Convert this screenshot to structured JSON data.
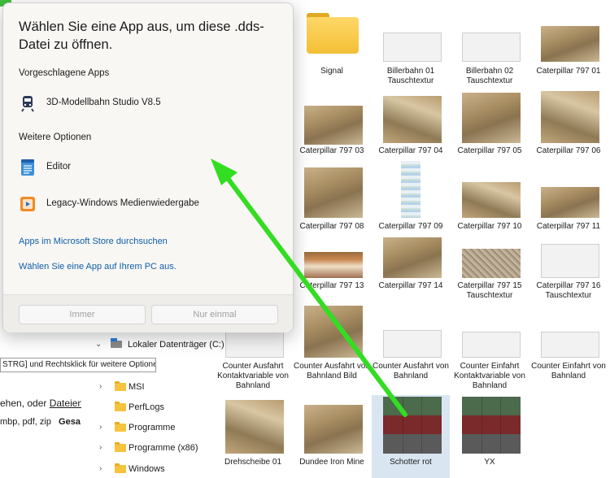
{
  "dialog": {
    "title": "Wählen Sie eine App aus, um diese .dds-Datei zu öffnen.",
    "suggested_header": "Vorgeschlagene Apps",
    "suggested_apps": [
      {
        "label": "3D-Modellbahn Studio V8.5",
        "icon": "train-icon"
      }
    ],
    "more_header": "Weitere Optionen",
    "more_apps": [
      {
        "label": "Editor",
        "icon": "notepad-icon"
      },
      {
        "label": "Legacy-Windows Medienwiedergabe",
        "icon": "media-player-icon"
      }
    ],
    "store_link": "Apps im Microsoft Store durchsuchen",
    "pc_link": "Wählen Sie eine App auf Ihrem PC aus.",
    "btn_always": "Immer",
    "btn_once": "Nur einmal"
  },
  "tooltip": "STRG] und Rechtsklick für weitere Optionen",
  "left_text": {
    "line1_prefix": "ehen, oder ",
    "line1_link": "Dateien",
    "line2": "mbp, pdf, zip",
    "line2_bold": "Gesa"
  },
  "tree": {
    "drive": "Lokaler Datenträger (C:)",
    "cut_label": "er",
    "items": [
      "MSI",
      "PerfLogs",
      "Programme",
      "Programme (x86)",
      "Windows"
    ]
  },
  "files": [
    {
      "name": "Signal",
      "kind": "folder"
    },
    {
      "name": "Billerbahn 01 Tauschtextur",
      "kind": "screen"
    },
    {
      "name": "Billerbahn 02 Tauschtextur",
      "kind": "screen"
    },
    {
      "name": "Caterpillar 797 01",
      "kind": "terrain"
    },
    {
      "name": "Caterpillar 797 03",
      "kind": "terrain"
    },
    {
      "name": "Caterpillar 797 04",
      "kind": "terrain"
    },
    {
      "name": "Caterpillar 797 05",
      "kind": "terrain"
    },
    {
      "name": "Caterpillar 797 06",
      "kind": "terrain"
    },
    {
      "name": "Caterpillar 797 08",
      "kind": "terrain"
    },
    {
      "name": "Caterpillar 797 09",
      "kind": "stripe"
    },
    {
      "name": "Caterpillar 797 10",
      "kind": "terrain"
    },
    {
      "name": "Caterpillar 797 11",
      "kind": "terrain"
    },
    {
      "name": "Caterpillar 797 13",
      "kind": "orange"
    },
    {
      "name": "Caterpillar 797 14",
      "kind": "terrain"
    },
    {
      "name": "Caterpillar 797 15 Tauschtextur",
      "kind": "gravel"
    },
    {
      "name": "Caterpillar 797 16 Tauschtextur",
      "kind": "screen"
    },
    {
      "name": "Counter Ausfahrt Kontaktvariable von Bahnland",
      "kind": "screen"
    },
    {
      "name": "Counter Ausfahrt von Bahnland Bild",
      "kind": "terrain"
    },
    {
      "name": "Counter Ausfahrt von Bahnland",
      "kind": "screen"
    },
    {
      "name": "Counter Einfahrt Kontaktvariable von Bahnland",
      "kind": "screen"
    },
    {
      "name": "Counter Einfahrt von Bahnland",
      "kind": "screen"
    },
    {
      "name": "Drehscheibe 01",
      "kind": "terrain"
    },
    {
      "name": "Dundee Iron Mine",
      "kind": "terrain"
    },
    {
      "name": "Schotter rot",
      "kind": "mosaic"
    },
    {
      "name": "YX",
      "kind": "mosaic"
    }
  ],
  "colors": {
    "arrow": "#33dd22",
    "link": "#0f5ea8",
    "folder": "#f6c33f"
  }
}
